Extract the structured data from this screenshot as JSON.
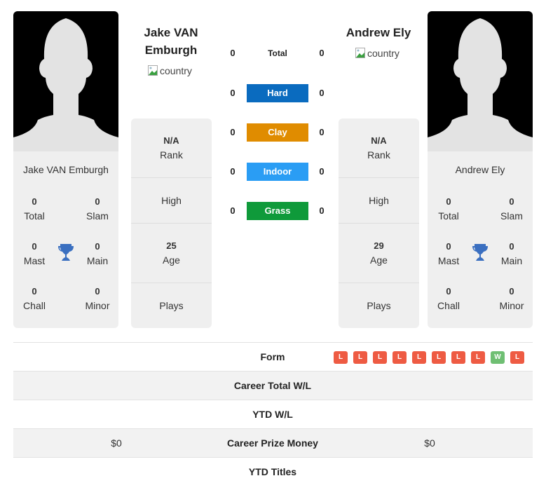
{
  "players": {
    "left": {
      "name": "Jake VAN Emburgh",
      "name_line1": "Jake VAN",
      "name_line2": "Emburgh",
      "country_alt": "country",
      "titles": {
        "total": {
          "value": "0",
          "label": "Total"
        },
        "slam": {
          "value": "0",
          "label": "Slam"
        },
        "mast": {
          "value": "0",
          "label": "Mast"
        },
        "main": {
          "value": "0",
          "label": "Main"
        },
        "chall": {
          "value": "0",
          "label": "Chall"
        },
        "minor": {
          "value": "0",
          "label": "Minor"
        }
      },
      "info": {
        "rank": {
          "value": "N/A",
          "label": "Rank"
        },
        "high": {
          "value": "",
          "label": "High"
        },
        "age": {
          "value": "25",
          "label": "Age"
        },
        "plays": {
          "value": "",
          "label": "Plays"
        }
      }
    },
    "right": {
      "name": "Andrew Ely",
      "country_alt": "country",
      "titles": {
        "total": {
          "value": "0",
          "label": "Total"
        },
        "slam": {
          "value": "0",
          "label": "Slam"
        },
        "mast": {
          "value": "0",
          "label": "Mast"
        },
        "main": {
          "value": "0",
          "label": "Main"
        },
        "chall": {
          "value": "0",
          "label": "Chall"
        },
        "minor": {
          "value": "0",
          "label": "Minor"
        }
      },
      "info": {
        "rank": {
          "value": "N/A",
          "label": "Rank"
        },
        "high": {
          "value": "",
          "label": "High"
        },
        "age": {
          "value": "29",
          "label": "Age"
        },
        "plays": {
          "value": "",
          "label": "Plays"
        }
      }
    }
  },
  "surfaces": [
    {
      "label": "Total",
      "left": "0",
      "right": "0",
      "color": ""
    },
    {
      "label": "Hard",
      "left": "0",
      "right": "0",
      "color": "#0a6bbf"
    },
    {
      "label": "Clay",
      "left": "0",
      "right": "0",
      "color": "#e08c00"
    },
    {
      "label": "Indoor",
      "left": "0",
      "right": "0",
      "color": "#2a9df4"
    },
    {
      "label": "Grass",
      "left": "0",
      "right": "0",
      "color": "#0f9a3a"
    }
  ],
  "comparison": {
    "form_label": "Form",
    "form": [
      "L",
      "L",
      "L",
      "L",
      "L",
      "L",
      "L",
      "L",
      "W",
      "L"
    ],
    "form_colors": {
      "L": "#ee5b43",
      "W": "#6fbf73"
    },
    "rows": [
      {
        "label": "Career Total W/L",
        "left": "",
        "right": ""
      },
      {
        "label": "YTD W/L",
        "left": "",
        "right": ""
      },
      {
        "label": "Career Prize Money",
        "left": "$0",
        "right": "$0"
      },
      {
        "label": "YTD Titles",
        "left": "",
        "right": ""
      }
    ]
  },
  "colors": {
    "trophy": "#3a6fc0",
    "card_bg": "#efefef"
  }
}
